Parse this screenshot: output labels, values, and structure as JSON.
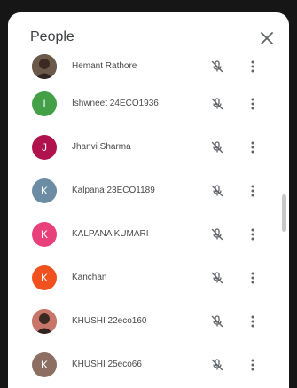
{
  "panel": {
    "title": "People",
    "close_icon": "close-icon"
  },
  "participants": [
    {
      "name": "Hemant Rathore",
      "initial": "",
      "color": "#6b5a4a",
      "photo": true,
      "mic_icon": "mic-off-icon",
      "more_icon": "more-vert-icon"
    },
    {
      "name": "Ishwneet 24ECO1936",
      "initial": "I",
      "color": "#43a047",
      "photo": false,
      "mic_icon": "mic-off-icon",
      "more_icon": "more-vert-icon"
    },
    {
      "name": "Jhanvi Sharma",
      "initial": "J",
      "color": "#b0124d",
      "photo": false,
      "mic_icon": "mic-off-icon",
      "more_icon": "more-vert-icon"
    },
    {
      "name": "Kalpana 23ECO1189",
      "initial": "K",
      "color": "#6b8ca3",
      "photo": false,
      "mic_icon": "mic-off-icon",
      "more_icon": "more-vert-icon"
    },
    {
      "name": "KALPANA KUMARI",
      "initial": "K",
      "color": "#e8407a",
      "photo": false,
      "mic_icon": "mic-off-icon",
      "more_icon": "more-vert-icon"
    },
    {
      "name": "Kanchan",
      "initial": "K",
      "color": "#f0511e",
      "photo": false,
      "mic_icon": "mic-off-icon",
      "more_icon": "more-vert-icon"
    },
    {
      "name": "KHUSHI 22eco160",
      "initial": "",
      "color": "#c9766a",
      "photo": true,
      "mic_icon": "mic-off-icon",
      "more_icon": "more-vert-icon"
    },
    {
      "name": "KHUSHI 25eco66",
      "initial": "K",
      "color": "#8d6e63",
      "photo": false,
      "mic_icon": "mic-off-icon",
      "more_icon": "more-vert-icon"
    }
  ]
}
